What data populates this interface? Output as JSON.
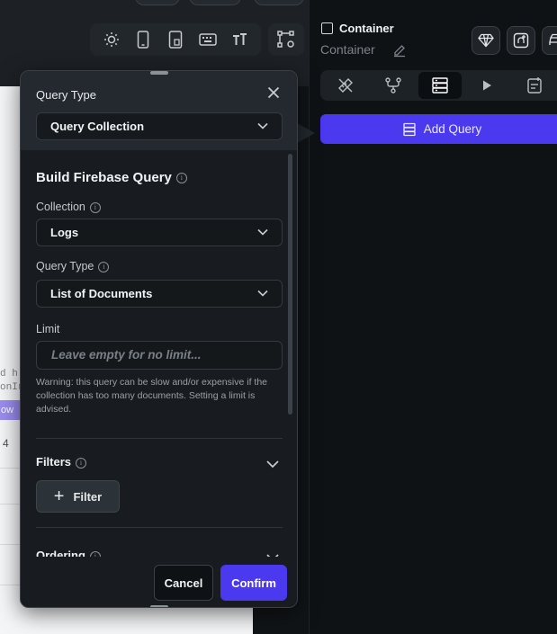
{
  "canvas": {
    "partial_texts": [
      "d h:",
      "onIr",
      "ow",
      "4"
    ]
  },
  "device_toolbar": {
    "icons": [
      "sun-icon",
      "phone-icon",
      "tablet-icon",
      "keyboard-icon",
      "text-size-icon"
    ],
    "extra_icon": "tree-settings-icon"
  },
  "right_panel": {
    "title": "Container",
    "subtitle": "Container",
    "action_icons": [
      "diamond-icon",
      "add-widget-icon",
      "car-icon"
    ],
    "tabs": [
      {
        "icon": "paint-icon",
        "active": false
      },
      {
        "icon": "actions-icon",
        "active": false
      },
      {
        "icon": "database-icon",
        "active": true
      },
      {
        "icon": "play-icon",
        "active": false
      },
      {
        "icon": "notes-icon",
        "active": false
      }
    ],
    "add_query_label": "Add Query"
  },
  "dialog": {
    "query_type_label": "Query Type",
    "query_type_value": "Query Collection",
    "section_title": "Build Firebase Query",
    "collection_label": "Collection",
    "collection_value": "Logs",
    "inner_query_type_label": "Query Type",
    "inner_query_type_value": "List of Documents",
    "limit_label": "Limit",
    "limit_placeholder": "Leave empty for no limit...",
    "warning_text": "Warning: this query can be slow and/or expensive if the collection has too many documents. Setting a limit is advised.",
    "filters_label": "Filters",
    "filter_button_label": "Filter",
    "ordering_label": "Ordering",
    "cancel_label": "Cancel",
    "confirm_label": "Confirm"
  },
  "colors": {
    "accent": "#4b39ef",
    "panel": "#181c20",
    "background": "#0f1214"
  }
}
